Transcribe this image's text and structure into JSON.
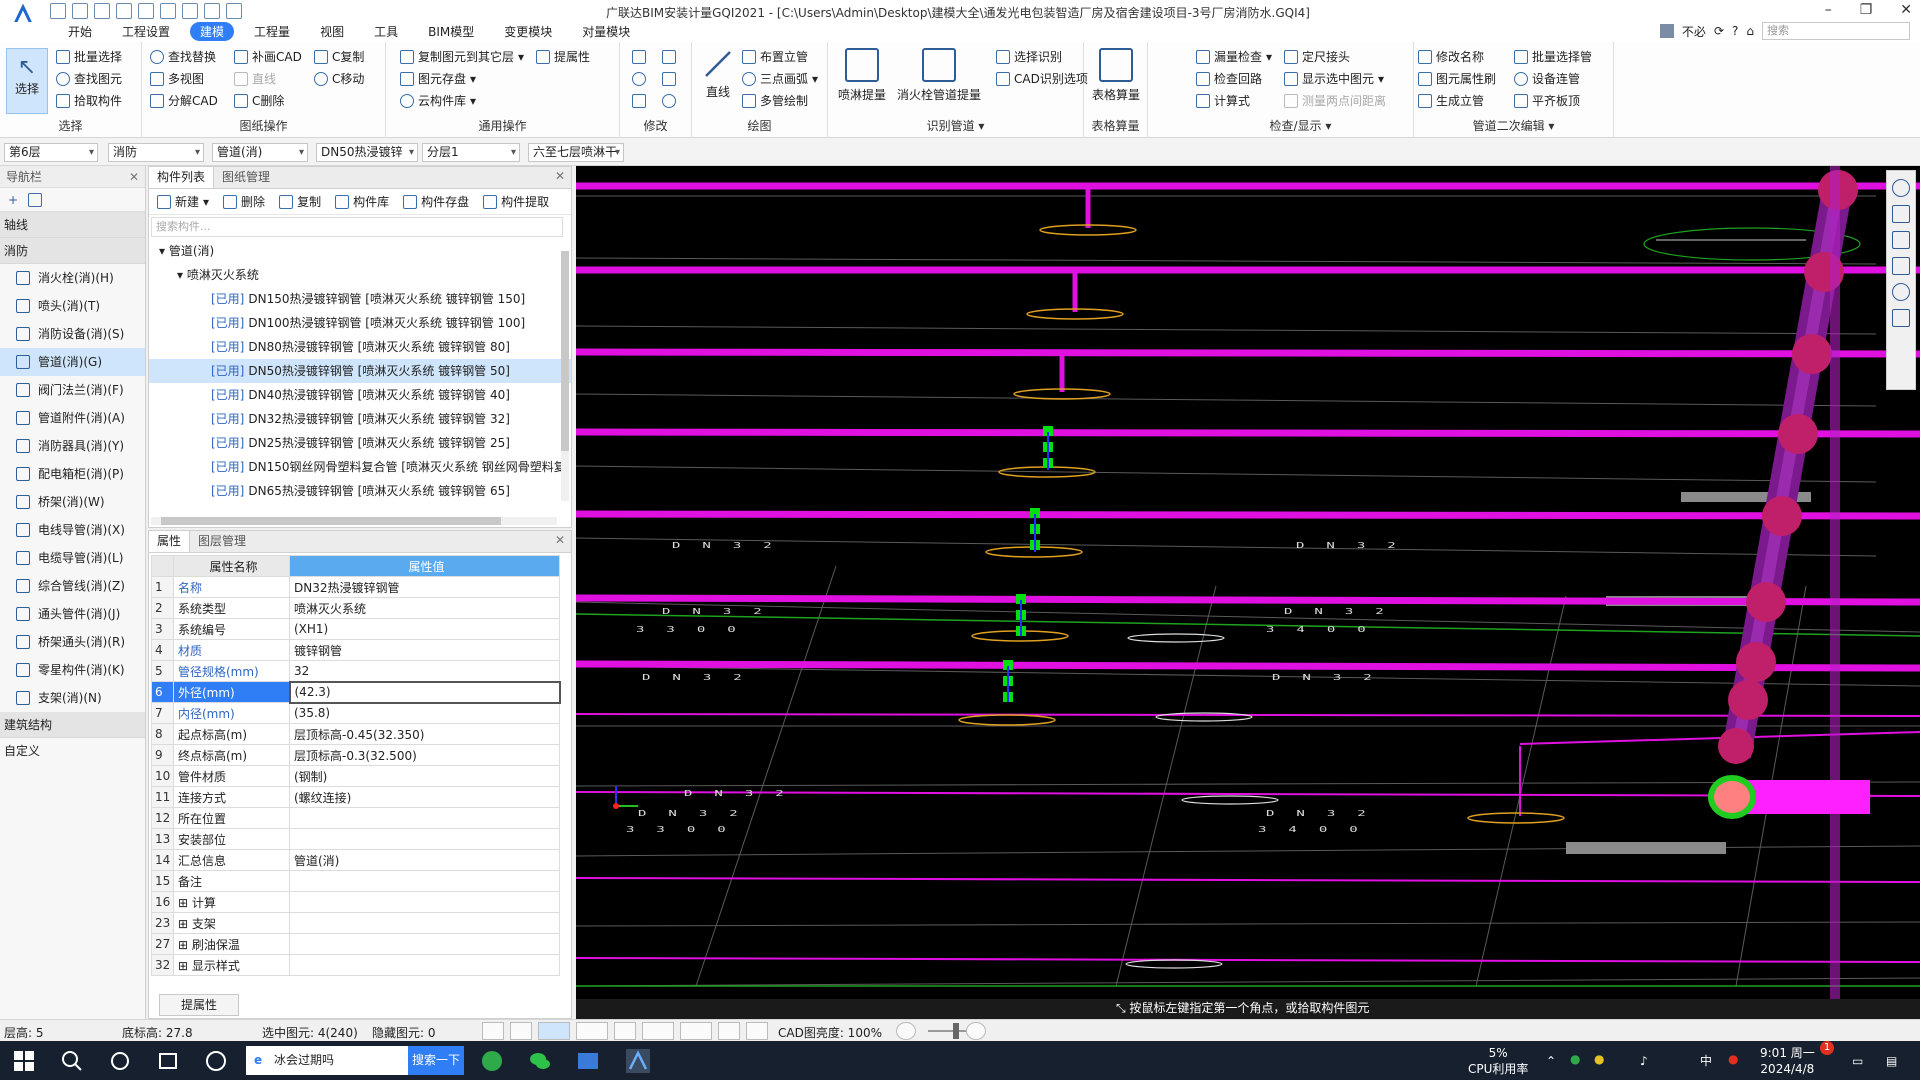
{
  "app": {
    "title": "广联达BIM安装计量GQI2021 - [C:\\Users\\Admin\\Desktop\\建模大全\\通发光电包装智造厂房及宿舍建设项目-3号厂房消防水.GQI4]",
    "user": "不必",
    "search_placeholder": "搜索"
  },
  "menu": [
    "开始",
    "工程设置",
    "建模",
    "工程量",
    "视图",
    "工具",
    "BIM模型",
    "变更模块",
    "对量模块"
  ],
  "menu_active": "建模",
  "ribbon": {
    "select": {
      "big": "选择",
      "items": [
        "批量选择",
        "查找图元",
        "拾取构件"
      ],
      "label": "选择"
    },
    "drawing_ops": {
      "items": [
        "查找替换",
        "多视图",
        "分解CAD",
        "补画CAD",
        "直线",
        "C删除",
        "C复制",
        "C移动"
      ],
      "label": "图纸操作"
    },
    "common_ops": {
      "items": [
        "复制图元到其它层",
        "图元存盘",
        "云构件库",
        "提属性"
      ],
      "label": "通用操作"
    },
    "modify": {
      "label": "修改"
    },
    "draw": {
      "big": "直线",
      "items": [
        "布置立管",
        "三点画弧",
        "多管绘制"
      ],
      "label": "绘图"
    },
    "recognize": {
      "big1": "喷淋提量",
      "big2": "消火栓管道提量",
      "items": [
        "选择识别",
        "CAD识别选项"
      ],
      "label": "识别管道"
    },
    "table_calc": {
      "big": "表格算量",
      "label": "表格算量"
    },
    "check": {
      "items": [
        "漏量检查",
        "检查回路",
        "计算式",
        "定尺接头",
        "显示选中图元",
        "测量两点间距离"
      ],
      "label": "检查/显示"
    },
    "secondary_edit": {
      "items": [
        "修改名称",
        "图元属性刷",
        "生成立管",
        "批量选择管",
        "设备连管",
        "平齐板顶"
      ],
      "label": "管道二次编辑"
    }
  },
  "filters": [
    "第6层",
    "消防",
    "管道(消)",
    "DN50热浸镀锌",
    "分层1",
    "六至七层喷淋干"
  ],
  "nav": {
    "title": "导航栏",
    "sections": [
      "轴线",
      "消防",
      "建筑结构",
      "自定义"
    ],
    "items": [
      "消火栓(消)(H)",
      "喷头(消)(T)",
      "消防设备(消)(S)",
      "管道(消)(G)",
      "阀门法兰(消)(F)",
      "管道附件(消)(A)",
      "消防器具(消)(Y)",
      "配电箱柜(消)(P)",
      "桥架(消)(W)",
      "电线导管(消)(X)",
      "电缆导管(消)(L)",
      "综合管线(消)(Z)",
      "通头管件(消)(J)",
      "桥架通头(消)(R)",
      "零星构件(消)(K)",
      "支架(消)(N)"
    ],
    "selected_index": 3
  },
  "component_list": {
    "tabs": [
      "构件列表",
      "图纸管理"
    ],
    "tools": [
      "新建",
      "删除",
      "复制",
      "构件库",
      "构件存盘",
      "构件提取"
    ],
    "search_placeholder": "搜索构件...",
    "root": "管道(消)",
    "system": "喷淋灭火系统",
    "items": [
      {
        "used": "[已用]",
        "text": "DN150热浸镀锌钢管 [喷淋灭火系统 镀锌钢管 150]"
      },
      {
        "used": "[已用]",
        "text": "DN100热浸镀锌钢管 [喷淋灭火系统 镀锌钢管 100]"
      },
      {
        "used": "[已用]",
        "text": "DN80热浸镀锌钢管 [喷淋灭火系统 镀锌钢管 80]"
      },
      {
        "used": "[已用]",
        "text": "DN50热浸镀锌钢管 [喷淋灭火系统 镀锌钢管 50]"
      },
      {
        "used": "[已用]",
        "text": "DN40热浸镀锌钢管 [喷淋灭火系统 镀锌钢管 40]"
      },
      {
        "used": "[已用]",
        "text": "DN32热浸镀锌钢管 [喷淋灭火系统 镀锌钢管 32]"
      },
      {
        "used": "[已用]",
        "text": "DN25热浸镀锌钢管 [喷淋灭火系统 镀锌钢管 25]"
      },
      {
        "used": "[已用]",
        "text": "DN150钢丝网骨塑料复合管 [喷淋灭火系统 钢丝网骨塑料复"
      },
      {
        "used": "[已用]",
        "text": "DN65热浸镀锌钢管 [喷淋灭火系统 镀锌钢管 65]"
      }
    ],
    "selected_index": 3
  },
  "properties": {
    "tabs": [
      "属性",
      "图层管理"
    ],
    "header_name": "属性名称",
    "header_value": "属性值",
    "rows": [
      {
        "n": "1",
        "k": "名称",
        "v": "DN32热浸镀锌钢管",
        "blue": true
      },
      {
        "n": "2",
        "k": "系统类型",
        "v": "喷淋灭火系统",
        "blue": false
      },
      {
        "n": "3",
        "k": "系统编号",
        "v": "(XH1)",
        "blue": false
      },
      {
        "n": "4",
        "k": "材质",
        "v": "镀锌钢管",
        "blue": true
      },
      {
        "n": "5",
        "k": "管径规格(mm)",
        "v": "32",
        "blue": true
      },
      {
        "n": "6",
        "k": "外径(mm)",
        "v": "(42.3)",
        "blue": true
      },
      {
        "n": "7",
        "k": "内径(mm)",
        "v": "(35.8)",
        "blue": true
      },
      {
        "n": "8",
        "k": "起点标高(m)",
        "v": "层顶标高-0.45(32.350)",
        "blue": false
      },
      {
        "n": "9",
        "k": "终点标高(m)",
        "v": "层顶标高-0.3(32.500)",
        "blue": false
      },
      {
        "n": "10",
        "k": "管件材质",
        "v": "(钢制)",
        "blue": false
      },
      {
        "n": "11",
        "k": "连接方式",
        "v": "(螺纹连接)",
        "blue": false
      },
      {
        "n": "12",
        "k": "所在位置",
        "v": "",
        "blue": false
      },
      {
        "n": "13",
        "k": "安装部位",
        "v": "",
        "blue": false
      },
      {
        "n": "14",
        "k": "汇总信息",
        "v": "管道(消)",
        "blue": false
      },
      {
        "n": "15",
        "k": "备注",
        "v": "",
        "blue": false
      },
      {
        "n": "16",
        "k": "⊞ 计算",
        "v": "",
        "blue": false
      },
      {
        "n": "23",
        "k": "⊞ 支架",
        "v": "",
        "blue": false
      },
      {
        "n": "27",
        "k": "⊞ 刷油保温",
        "v": "",
        "blue": false
      },
      {
        "n": "32",
        "k": "⊞ 显示样式",
        "v": "",
        "blue": false
      }
    ],
    "selected_row": 5,
    "extract_button": "提属性"
  },
  "viewport": {
    "hint": "按鼠标左键指定第一个角点，或拾取构件图元",
    "labels": [
      "DN32",
      "DN32",
      "DN32",
      "DN32",
      "DN32",
      "DN32",
      "DN32",
      "DN32",
      "DN32",
      "3300",
      "3300",
      "3400",
      "3400"
    ]
  },
  "status": {
    "floor_height": "层高: 5",
    "base_elev": "底标高: 27.8",
    "selected": "选中图元: 4(240)",
    "hidden": "隐藏图元: 0",
    "cad_brightness": "CAD图亮度: 100%"
  },
  "taskbar": {
    "browser_text": "冰会过期吗",
    "search_button": "搜索一下",
    "cpu": "5%",
    "cpu_label": "CPU利用率",
    "ime": "中",
    "time": "9:01 周一",
    "date": "2024/4/8",
    "notification": "1"
  },
  "colors": {
    "accent": "#2f7ef5",
    "pipe": "#e010e0",
    "riser": "#7a1a8c",
    "viewport_bg": "#000000"
  }
}
